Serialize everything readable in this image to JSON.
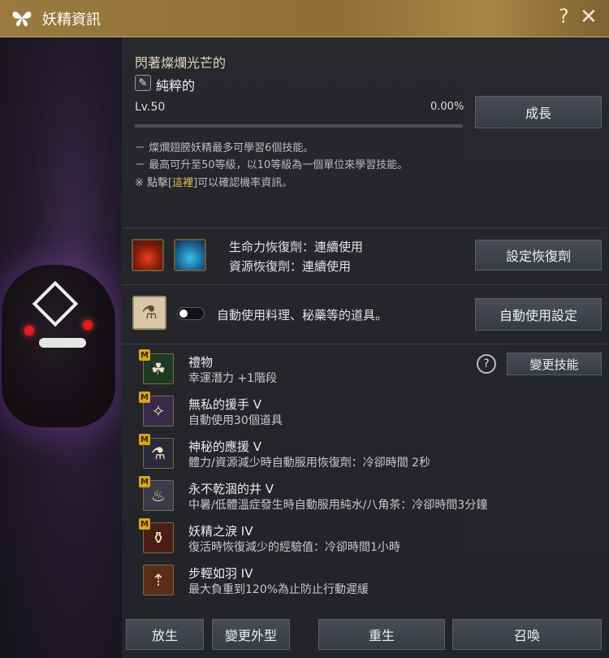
{
  "window": {
    "title": "妖精資訊",
    "help": "?",
    "close": "✕"
  },
  "fairy": {
    "prefix": "閃著燦爛光芒的",
    "name": "純粹的",
    "level": "Lv.50",
    "exp_percent": "0.00%",
    "exp_fraction": 0.0
  },
  "buttons": {
    "grow": "成長",
    "set_potion": "設定恢復劑",
    "auto_use": "自動使用設定",
    "change_skill": "變更技能",
    "release": "放生",
    "change_look": "變更外型",
    "rebirth": "重生",
    "summon": "召喚"
  },
  "info": {
    "line1": "－ 燦爛翅膀妖精最多可學習6個技能。",
    "line2": "－ 最高可升至50等級，以10等級為一個單位來學習技能。",
    "line3_pre": "※ 點擊[",
    "line3_link": "這裡",
    "line3_post": "]可以確認機率資訊。"
  },
  "potions": {
    "hp": "生命力恢復劑：連續使用",
    "mp": "資源恢復劑：連續使用"
  },
  "auto": {
    "label": "自動使用料理、秘藥等的道具。",
    "toggle_on": false
  },
  "skills": [
    {
      "name": "禮物",
      "desc": "幸運潛力 +1階段",
      "badge": "M",
      "icon": "clover-icon",
      "glyph": "☘"
    },
    {
      "name": "無私的援手 V",
      "desc": "自動使用30個道具",
      "badge": "M",
      "icon": "fairy-icon",
      "glyph": "✧"
    },
    {
      "name": "神秘的應援 V",
      "desc": "體力/資源減少時自動服用恢復劑：冷卻時間 2秒",
      "badge": "M",
      "icon": "potion-icon",
      "glyph": "⚗"
    },
    {
      "name": "永不乾涸的井 V",
      "desc": "中暑/低體溫症發生時自動服用純水/八角茶：冷卻時間3分鐘",
      "badge": "M",
      "icon": "well-icon",
      "glyph": "♨"
    },
    {
      "name": "妖精之淚 IV",
      "desc": "復活時恢復減少的經驗值：冷卻時間1小時",
      "badge": "M",
      "icon": "tear-icon",
      "glyph": "⚱"
    },
    {
      "name": "步輕如羽 IV",
      "desc": "最大負重到120%為止防止行動遲緩",
      "badge": "",
      "icon": "feather-bag-icon",
      "glyph": "⇡"
    }
  ],
  "colors": {
    "title_bar": "#9a7a3e",
    "link": "#e6c45a",
    "badge": "#d9a21f"
  }
}
